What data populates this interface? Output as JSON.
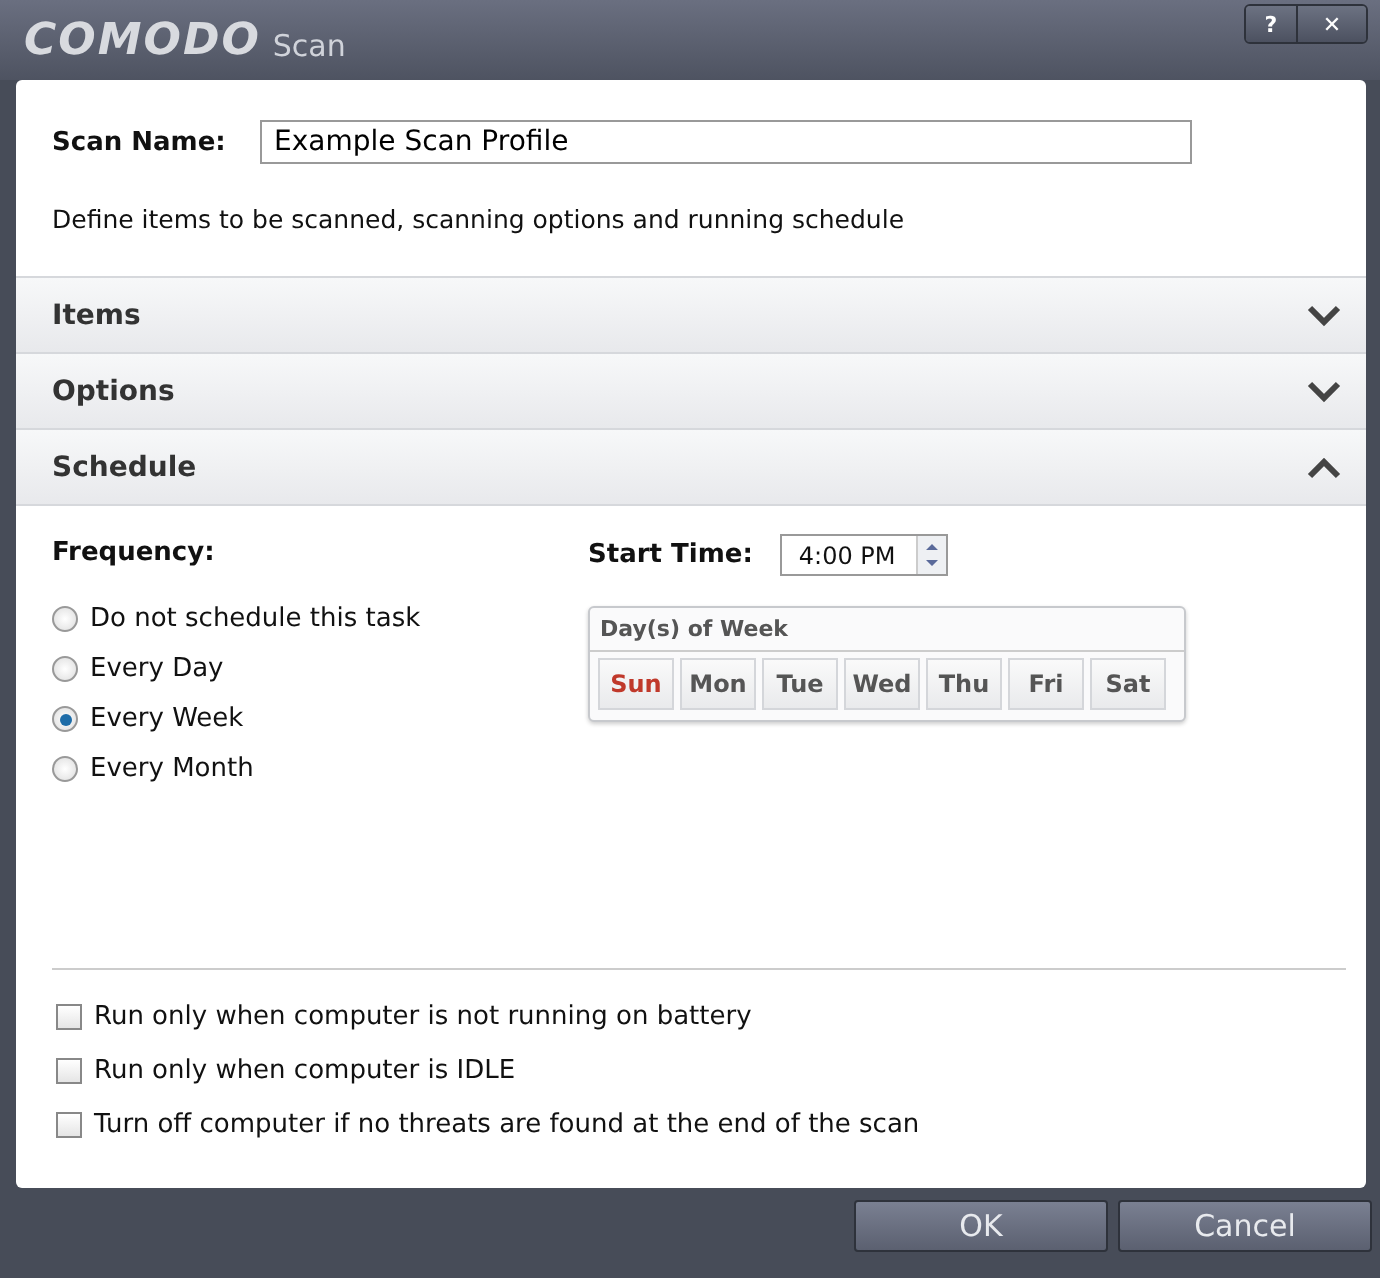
{
  "window": {
    "logo": "COMODO",
    "title": "Scan",
    "buttons": [
      "?",
      "✕"
    ]
  },
  "scan_name": {
    "label": "Scan Name:",
    "value": "Example Scan Profile"
  },
  "description": "Define items to be scanned, scanning options and running schedule",
  "sections": [
    {
      "label": "Items",
      "expanded": false
    },
    {
      "label": "Options",
      "expanded": false
    },
    {
      "label": "Schedule",
      "expanded": true
    }
  ],
  "frequency": {
    "label": "Frequency:",
    "options": [
      {
        "label": "Do not schedule this task",
        "selected": false
      },
      {
        "label": "Every Day",
        "selected": false
      },
      {
        "label": "Every Week",
        "selected": true
      },
      {
        "label": "Every Month",
        "selected": false
      }
    ]
  },
  "start_time": {
    "label": "Start Time:",
    "value": "4:00 PM"
  },
  "days_of_week": {
    "title": "Day(s) of Week",
    "days": [
      {
        "label": "Sun",
        "selected": true
      },
      {
        "label": "Mon",
        "selected": false
      },
      {
        "label": "Tue",
        "selected": false
      },
      {
        "label": "Wed",
        "selected": false
      },
      {
        "label": "Thu",
        "selected": false
      },
      {
        "label": "Fri",
        "selected": false
      },
      {
        "label": "Sat",
        "selected": false
      }
    ]
  },
  "conditions": [
    {
      "label": "Run only when computer is not running on battery",
      "checked": false
    },
    {
      "label": "Run only when computer is IDLE",
      "checked": false
    },
    {
      "label": "Turn off computer if no threats are found at the end of the scan",
      "checked": false
    }
  ],
  "buttons": [
    "OK",
    "Cancel"
  ]
}
